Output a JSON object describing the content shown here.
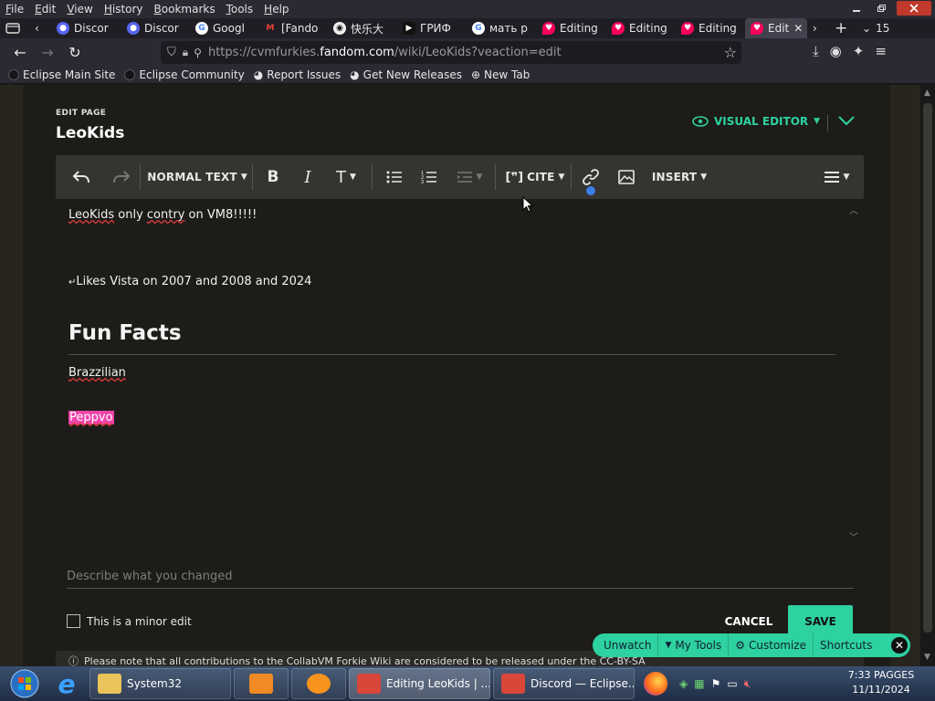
{
  "menubar": {
    "items": [
      {
        "u": "F",
        "rest": "ile"
      },
      {
        "u": "E",
        "rest": "dit"
      },
      {
        "u": "V",
        "rest": "iew"
      },
      {
        "u": "H",
        "rest": "istory"
      },
      {
        "u": "B",
        "rest": "ookmarks"
      },
      {
        "u": "T",
        "rest": "ools"
      },
      {
        "u": "H",
        "rest": "elp"
      }
    ]
  },
  "tabs": [
    {
      "label": "Discor",
      "icon": "discord-icon",
      "color": "#5865f2"
    },
    {
      "label": "Discor",
      "icon": "discord-icon",
      "color": "#5865f2"
    },
    {
      "label": "Googl",
      "icon": "google-icon",
      "color": "#4285f4"
    },
    {
      "label": "[Fando",
      "icon": "gmail-icon",
      "color": "#ea4335"
    },
    {
      "label": "快乐大",
      "icon": "cat-icon",
      "color": "#333333"
    },
    {
      "label": "ГРИФ",
      "icon": "youtube-icon",
      "color": "#ff0000"
    },
    {
      "label": "мать р",
      "icon": "google-icon",
      "color": "#4285f4"
    },
    {
      "label": "Editing",
      "icon": "fandom-icon",
      "color": "#fa005a"
    },
    {
      "label": "Editing",
      "icon": "fandom-icon",
      "color": "#fa005a"
    },
    {
      "label": "Editing",
      "icon": "fandom-icon",
      "color": "#fa005a"
    },
    {
      "label": "Edit",
      "icon": "fandom-icon",
      "color": "#fa005a",
      "active": true
    }
  ],
  "tabcount": "15",
  "url": {
    "prefix": "https://cvmfurkies.",
    "host": "fandom.com",
    "path": "/wiki/LeoKids?veaction=edit"
  },
  "bookmarks": [
    {
      "label": "Eclipse Main Site",
      "icon": "eclipse-icon"
    },
    {
      "label": "Eclipse Community",
      "icon": "eclipse-icon"
    },
    {
      "label": "Report Issues",
      "icon": "github-icon"
    },
    {
      "label": "Get New Releases",
      "icon": "github-icon"
    },
    {
      "label": "New Tab",
      "icon": "globe-icon"
    }
  ],
  "editor": {
    "edit_label": "EDIT PAGE",
    "page_title": "LeoKids",
    "visual_editor_label": "VISUAL EDITOR",
    "toolbar": {
      "paragraph_format": "NORMAL TEXT",
      "cite": "CITE",
      "insert": "INSERT"
    },
    "content": {
      "line1_a": "LeoKids",
      "line1_b": " only ",
      "line1_c": "contry",
      "line1_d": " on VM8!!!!!",
      "line2": "Likes Vista on 2007 and 2008 and 2024",
      "heading": "Fun Facts",
      "line3": "Brazzilian",
      "line4": "Peppvo"
    },
    "summary_placeholder": "Describe what you changed",
    "minor_edit_label": "This is a minor edit",
    "cancel_label": "CANCEL",
    "save_label": "SAVE",
    "notice": "Please note that all contributions to the CollabVM Forkie Wiki are considered to be released under the CC-BY-SA"
  },
  "tools_bar": {
    "unwatch": "Unwatch",
    "my_tools": "My Tools",
    "customize": "Customize",
    "shortcuts": "Shortcuts"
  },
  "taskbar": {
    "items": [
      {
        "label": "System32",
        "icon": "folder-icon",
        "color": "#e8c45a"
      },
      {
        "label": "",
        "icon": "media-player-icon",
        "color": "#f08a24"
      },
      {
        "label": "",
        "icon": "uc-browser-icon",
        "color": "#f7941d"
      },
      {
        "label": "Editing LeoKids | ...",
        "icon": "fandom-icon",
        "color": "#d9463a",
        "active": true
      },
      {
        "label": "Discord — Eclipse...",
        "icon": "fandom-icon",
        "color": "#d9463a"
      }
    ],
    "clock_time": "7:33 PAGGES",
    "clock_date": "11/11/2024"
  }
}
